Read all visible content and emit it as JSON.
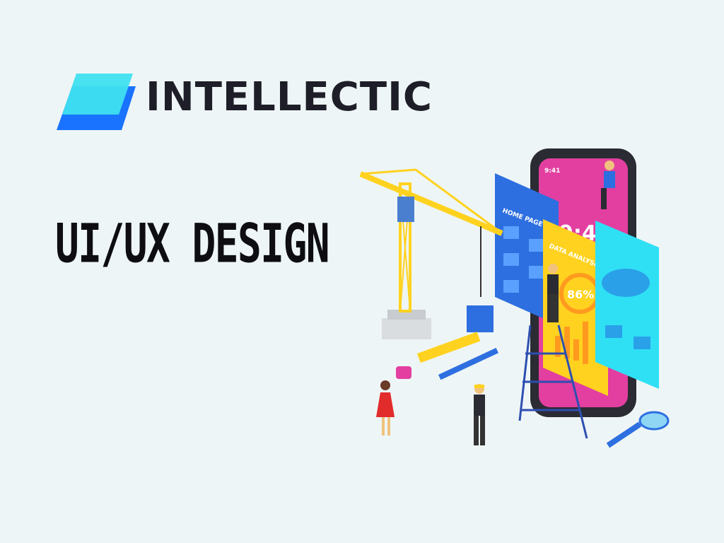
{
  "brand": {
    "name": "INTELLECTIC",
    "colors": {
      "mark_front": "#3fe0f0",
      "mark_back": "#1a73ff",
      "text": "#1e1e28"
    }
  },
  "headline": "UI/UX DESIGN",
  "illustration": {
    "description_icon": "construction-of-app-interface-icon",
    "phone_time": "9:41",
    "phone_clock": "9:4",
    "panel_home": "HOME PAGE",
    "panel_data": "DATA ANALYSIS",
    "panel_percent": "86%",
    "colors": {
      "background": "#eef5f6",
      "phone": "#2b2b33",
      "phone_screen": "#e23fa0",
      "panel_blue": "#2d6fe0",
      "panel_yellow": "#ffd21f",
      "panel_cyan": "#2fe0f5",
      "crane": "#ffd21f"
    }
  }
}
